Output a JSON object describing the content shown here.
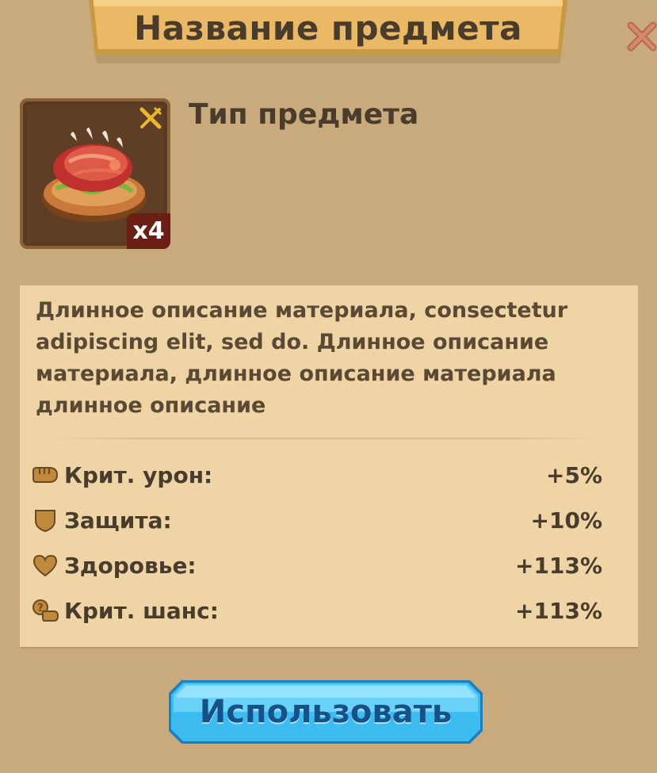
{
  "dialog": {
    "title": "Название предмета",
    "close_icon": "close-icon"
  },
  "item": {
    "icon": "meat-dish-icon",
    "category_icon": "fork-knife-icon",
    "quantity": "x4",
    "type": "Тип предмета"
  },
  "info": {
    "description": "Длинное описание материала, consectetur adipiscing elit, sed do. Длинное описание материала, длинное описание материала длинное описание",
    "stats": [
      {
        "icon": "fist-icon",
        "label": "Крит. урон:",
        "value": "+5%"
      },
      {
        "icon": "shield-icon",
        "label": "Защита:",
        "value": "+10%"
      },
      {
        "icon": "heart-icon",
        "label": "Здоровье:",
        "value": "+113%"
      },
      {
        "icon": "crit-chance-icon",
        "label": "Крит. шанс:",
        "value": "+113%"
      }
    ]
  },
  "actions": {
    "use_label": "Использовать"
  },
  "colors": {
    "background": "#c8aa7c",
    "ribbon": "#e9b966",
    "info_box": "#efd5a5",
    "text": "#4a3c2c",
    "button": "#3cbcf0",
    "button_text": "#16518a",
    "close": "#c47a5a"
  }
}
